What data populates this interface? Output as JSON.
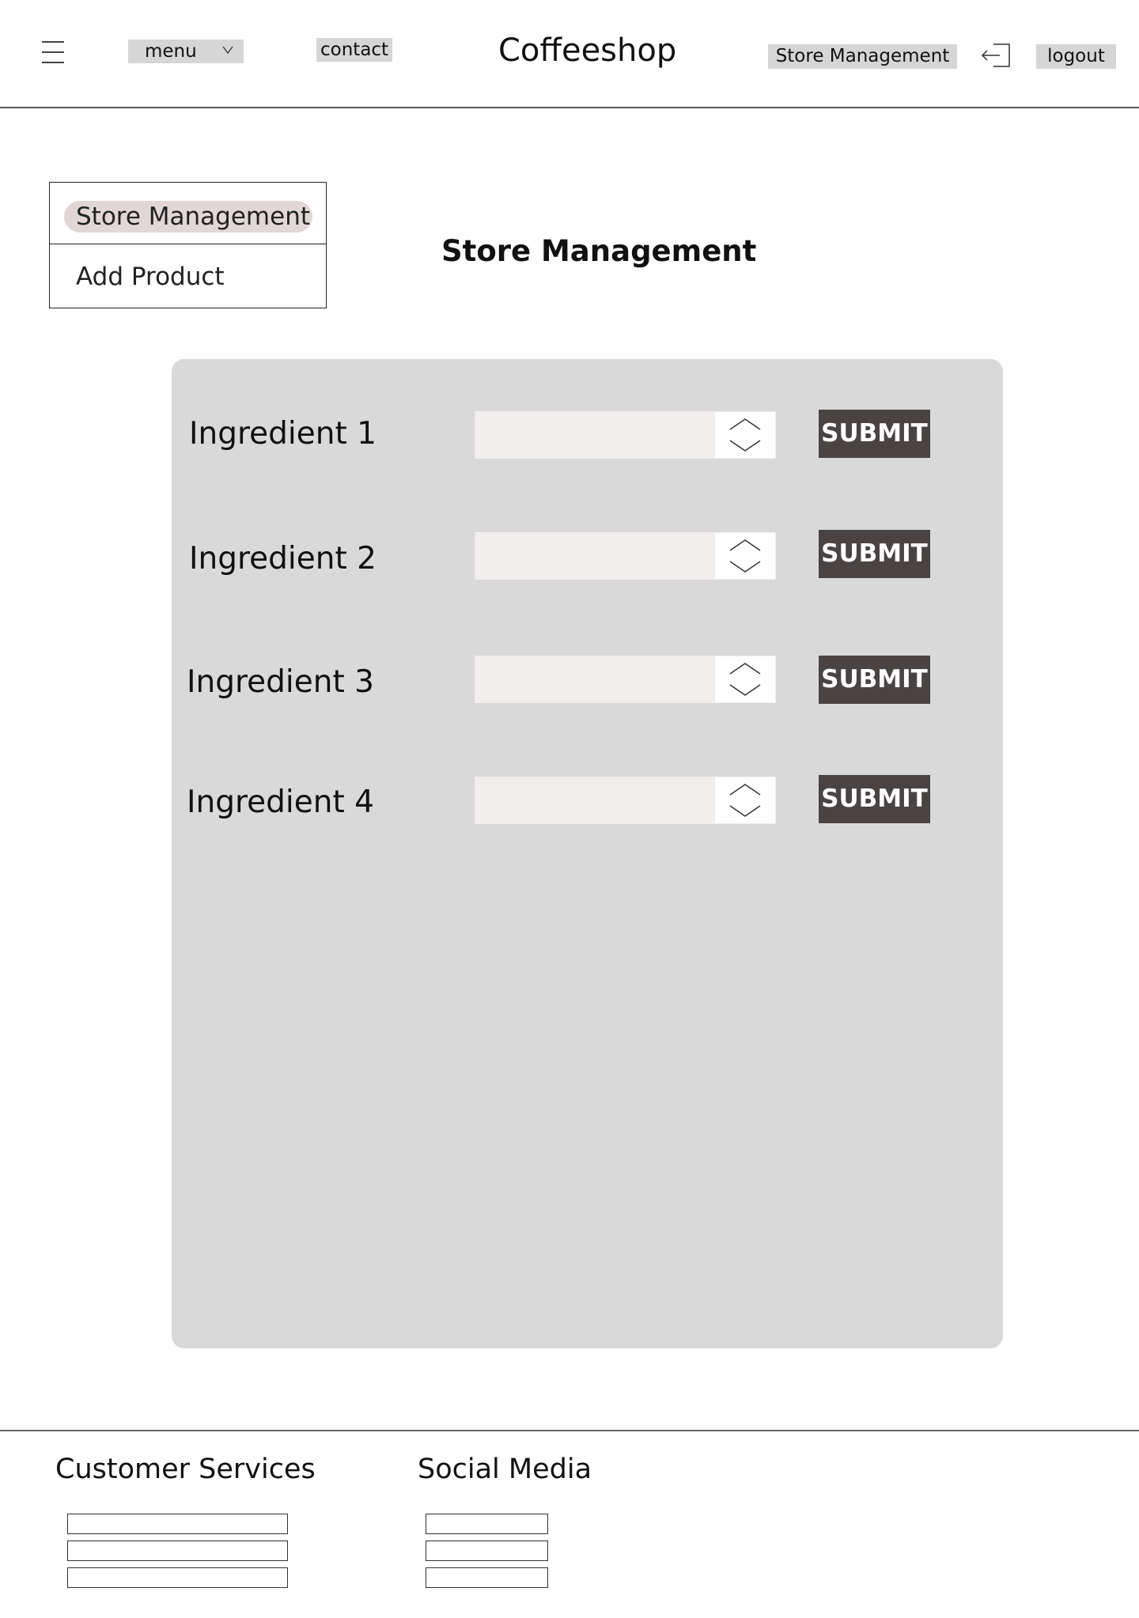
{
  "header": {
    "menu_label": "menu",
    "contact_label": "contact",
    "brand": "Coffeeshop",
    "store_management_label": "Store Management",
    "logout_label": "logout",
    "icons": [
      "hamburger-icon",
      "chevron-down-icon",
      "logout-icon"
    ]
  },
  "side_nav": {
    "items": [
      {
        "label": "Store Management",
        "active": true
      },
      {
        "label": "Add Product",
        "active": false
      }
    ],
    "active_color": "#e2d7d7"
  },
  "main": {
    "title": "Store Management",
    "rows": [
      {
        "label": "Ingredient 1",
        "value": "",
        "submit_label": "SUBMIT"
      },
      {
        "label": "Ingredient 2",
        "value": "",
        "submit_label": "SUBMIT"
      },
      {
        "label": "Ingredient 3",
        "value": "",
        "submit_label": "SUBMIT"
      },
      {
        "label": "Ingredient 4",
        "value": "",
        "submit_label": "SUBMIT"
      }
    ],
    "panel_color": "#d9d9d9",
    "submit_color": "#4a4343"
  },
  "footer": {
    "customer_services_heading": "Customer Services",
    "social_media_heading": "Social Media"
  }
}
